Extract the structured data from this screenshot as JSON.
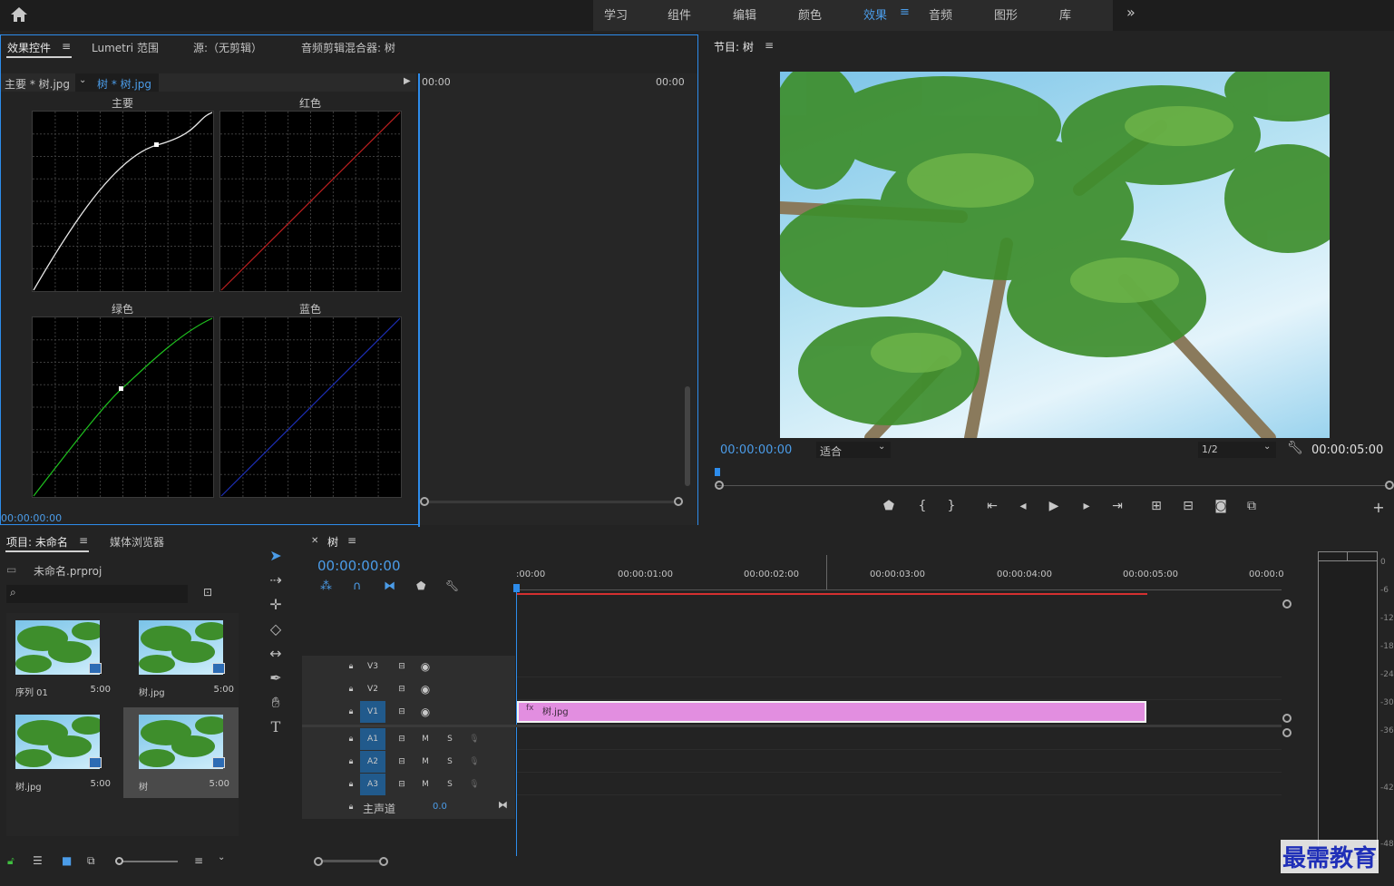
{
  "topbar": {
    "tabs": [
      "学习",
      "组件",
      "编辑",
      "颜色",
      "效果",
      "音频",
      "图形",
      "库"
    ],
    "active_tab": "效果",
    "overflow": "»"
  },
  "effect_panel": {
    "tabs": [
      "效果控件",
      "Lumetri 范围",
      "源:（无剪辑）",
      "音频剪辑混合器: 树"
    ],
    "menu_icon": "≡",
    "clip_master": "主要 * 树.jpg",
    "clip_current": "树 * 树.jpg",
    "time_start": "00:00",
    "time_end": "00:00",
    "curves": [
      "主要",
      "红色",
      "绿色",
      "蓝色"
    ],
    "timecode": "00:00:00:00"
  },
  "program_monitor": {
    "title": "节目: 树",
    "timecode": "00:00:00:00",
    "fit": "适合",
    "resolution": "1/2",
    "duration": "00:00:05:00"
  },
  "project_panel": {
    "tabs": [
      "项目: 未命名",
      "媒体浏览器"
    ],
    "project_file": "未命名.prproj",
    "items": [
      {
        "name": "序列 01",
        "duration": "5:00"
      },
      {
        "name": "树.jpg",
        "duration": "5:00"
      },
      {
        "name": "树.jpg",
        "duration": "5:00"
      },
      {
        "name": "树",
        "duration": "5:00"
      }
    ]
  },
  "timeline": {
    "sequence": "树",
    "timecode": "00:00:00:00",
    "ruler": [
      ":00:00",
      "00:00:01:00",
      "00:00:02:00",
      "00:00:03:00",
      "00:00:04:00",
      "00:00:05:00",
      "00:00:0"
    ],
    "video_tracks": [
      "V3",
      "V2",
      "V1"
    ],
    "audio_tracks": [
      "A1",
      "A2",
      "A3"
    ],
    "master_label": "主声道",
    "master_value": "0.0",
    "clip_name": "树.jpg",
    "clip_color": "#e28ee0"
  },
  "meter_scale": [
    "0",
    "-6",
    "-12",
    "-18",
    "-24",
    "-30",
    "-36",
    "-42",
    "-48"
  ],
  "watermark": "最需教育"
}
